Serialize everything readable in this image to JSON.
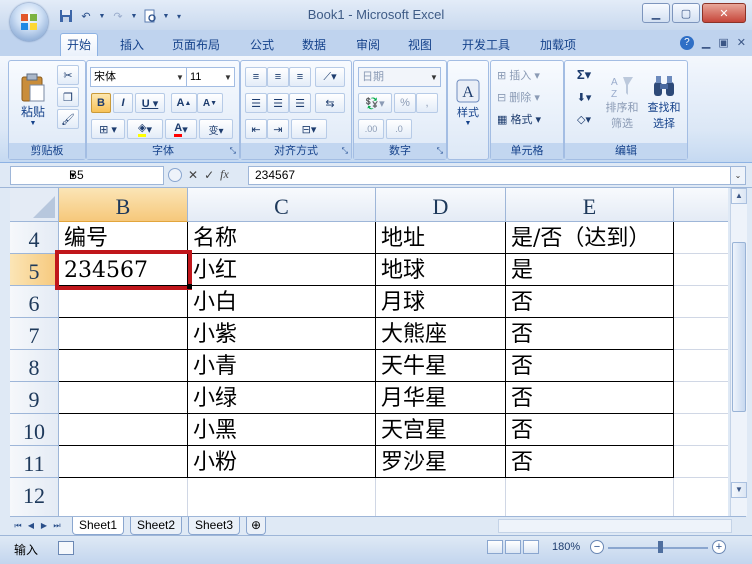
{
  "window": {
    "title": "Book1 - Microsoft Excel"
  },
  "tabs": [
    "开始",
    "插入",
    "页面布局",
    "公式",
    "数据",
    "审阅",
    "视图",
    "开发工具",
    "加载项"
  ],
  "active_tab": "开始",
  "ribbon": {
    "clipboard": {
      "label": "剪贴板",
      "paste": "粘贴"
    },
    "font": {
      "label": "字体",
      "name": "宋体",
      "size": "11"
    },
    "alignment": {
      "label": "对齐方式"
    },
    "number": {
      "label": "数字",
      "format": "日期"
    },
    "styles": {
      "label": "样式"
    },
    "cells": {
      "label": "单元格",
      "insert": "插入",
      "delete": "删除",
      "format": "格式"
    },
    "editing": {
      "label": "编辑",
      "sort_filter_1": "排序和",
      "sort_filter_2": "筛选",
      "find_select_1": "查找和",
      "find_select_2": "选择"
    }
  },
  "formula_bar": {
    "name_box": "B5",
    "fx": "fx",
    "value": "234567"
  },
  "grid": {
    "columns": [
      "B",
      "C",
      "D",
      "E"
    ],
    "selected_column": "B",
    "rows": [
      "4",
      "5",
      "6",
      "7",
      "8",
      "9",
      "10",
      "11",
      "12"
    ],
    "selected_row": "5",
    "cells": [
      [
        "编号",
        "名称",
        "地址",
        "是/否（达到）"
      ],
      [
        "234567",
        "小红",
        "地球",
        "是"
      ],
      [
        "",
        "小白",
        "月球",
        "否"
      ],
      [
        "",
        "小紫",
        "大熊座",
        "否"
      ],
      [
        "",
        "小青",
        "天牛星",
        "否"
      ],
      [
        "",
        "小绿",
        "月华星",
        "否"
      ],
      [
        "",
        "小黑",
        "天宫星",
        "否"
      ],
      [
        "",
        "小粉",
        "罗沙星",
        "否"
      ],
      [
        "",
        "",
        "",
        ""
      ]
    ]
  },
  "sheets": [
    "Sheet1",
    "Sheet2",
    "Sheet3"
  ],
  "active_sheet": "Sheet1",
  "status": {
    "mode": "输入",
    "zoom": "180%"
  },
  "colors": {
    "selection_border": "#c0161b",
    "header_selected": "#f6c87b"
  }
}
